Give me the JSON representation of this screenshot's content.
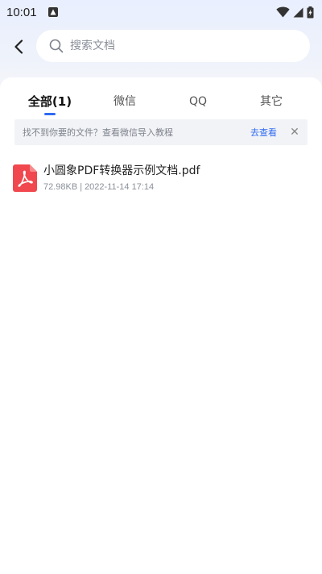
{
  "status_bar": {
    "time": "10:01",
    "notification_icon": "android-notification-icon",
    "wifi_icon": "wifi-icon",
    "signal_icon": "cell-signal-icon",
    "battery_icon": "battery-charging-icon"
  },
  "header": {
    "back_icon": "chevron-left-icon",
    "search": {
      "icon": "search-icon",
      "placeholder": "搜索文档",
      "value": ""
    }
  },
  "tabs": [
    {
      "label": "全部(1)",
      "active": true
    },
    {
      "label": "微信",
      "active": false
    },
    {
      "label": "QQ",
      "active": false
    },
    {
      "label": "其它",
      "active": false
    }
  ],
  "tip": {
    "text": "找不到你要的文件？查看微信导入教程",
    "link": "去查看",
    "close": "✕"
  },
  "files": [
    {
      "icon": "pdf-file-icon",
      "name": "小圆象PDF转换器示例文档.pdf",
      "size": "72.98KB",
      "separator": "|",
      "date": "2022-11-14 17:14"
    }
  ],
  "colors": {
    "accent": "#2f6bf2",
    "pdf_icon": "#f0484e"
  }
}
